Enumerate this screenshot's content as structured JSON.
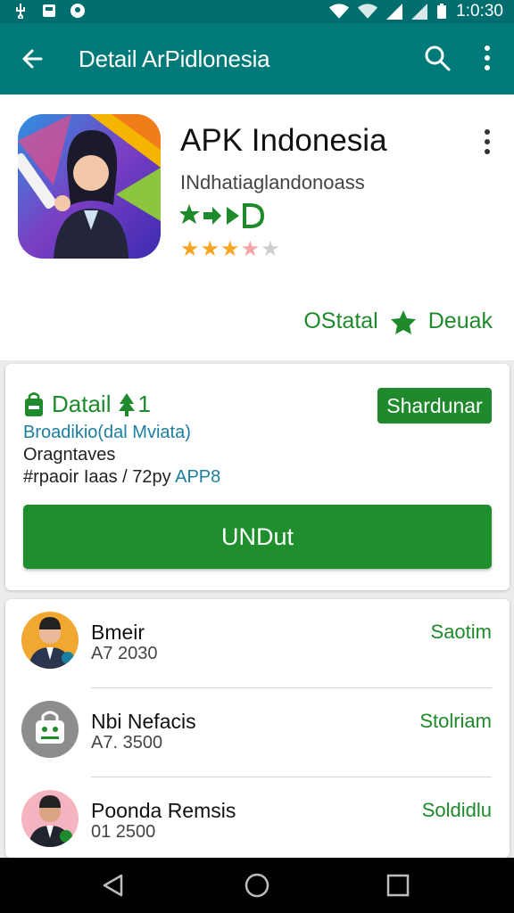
{
  "status_bar": {
    "time": "1:0:30",
    "icons": [
      "usb-icon",
      "photo-icon",
      "circle-notif-icon",
      "wifi-icon",
      "wifi-alt-icon",
      "signal-icon",
      "signal-alt-icon",
      "battery-icon"
    ]
  },
  "appbar": {
    "title": "Detail ArPidlonesia",
    "icons": [
      "back-arrow-icon",
      "search-icon",
      "more-vert-icon"
    ]
  },
  "app": {
    "name": "APK Indonesia",
    "developer": "INdhatiaglandonoass",
    "rating_stars": 3.5,
    "rating_max": 5,
    "actions": {
      "install_label": "OStatal",
      "wishlist_label": "Deuak"
    }
  },
  "detail": {
    "title": "Datail",
    "badge": "1",
    "link": "Broadikio(dal Mviata)",
    "line1": "Oragntaves",
    "line2_prefix": "#rpaoir Iaas / 72py",
    "line2_accent": "APP8",
    "share_label": "Shardunar",
    "download_label": "UNDut"
  },
  "list": {
    "items": [
      {
        "name": "Bmeir",
        "meta": "A7 2030",
        "action": "Saotim",
        "avatar": "man-suit-avatar"
      },
      {
        "name": "Nbi Nefacis",
        "meta": "A7. 3500",
        "action": "Stolriam",
        "avatar": "android-bag-avatar"
      },
      {
        "name": "Poonda Remsis",
        "meta": "01 2500",
        "action": "Soldidlu",
        "avatar": "man-pink-avatar"
      }
    ]
  },
  "colors": {
    "teal_bar": "#007a78",
    "status_bar": "#006e6e",
    "green_accent": "#1e8a2c",
    "link_blue": "#1b7fa0",
    "star_orange": "#f5a623"
  }
}
